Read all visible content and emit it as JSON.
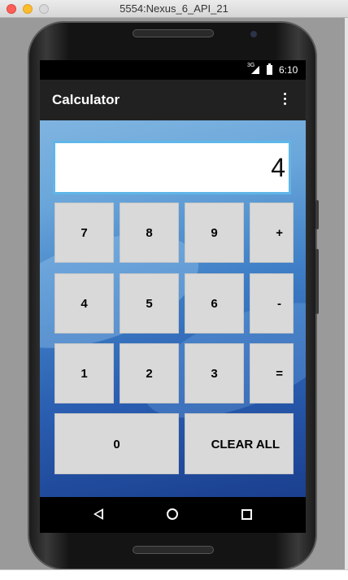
{
  "window": {
    "title": "5554:Nexus_6_API_21"
  },
  "status_bar": {
    "network": "3G",
    "time": "6:10"
  },
  "app_bar": {
    "title": "Calculator",
    "overflow_icon": "more-vert-icon"
  },
  "display": {
    "value": "4"
  },
  "keys": {
    "k7": "7",
    "k8": "8",
    "k9": "9",
    "plus": "+",
    "k4": "4",
    "k5": "5",
    "k6": "6",
    "minus": "-",
    "k1": "1",
    "k2": "2",
    "k3": "3",
    "equals": "=",
    "k0": "0",
    "clear_all": "CLEAR ALL"
  },
  "nav_bar": {
    "back_icon": "back-icon",
    "home_icon": "home-icon",
    "recents_icon": "recents-icon"
  },
  "colors": {
    "accent": "#5fb6e8",
    "key_bg": "#d9d9d9",
    "app_bar": "#212121"
  }
}
